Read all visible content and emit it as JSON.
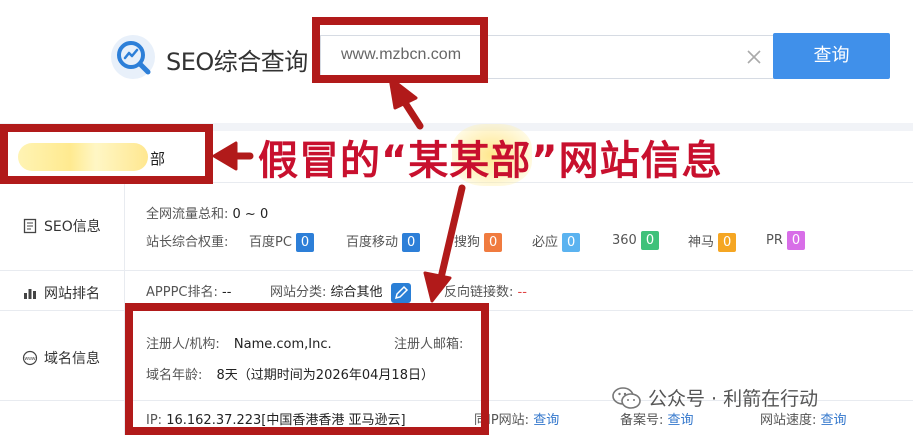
{
  "header": {
    "logo_text": "SEO综合查询",
    "search_value": "www.mzbcn.com",
    "search_button": "查询"
  },
  "site": {
    "name_suffix": "部"
  },
  "seo_info": {
    "label": "SEO信息",
    "traffic_label": "全网流量总和:",
    "traffic_value": "0 ~ 0",
    "weight_label": "站长综合权重:",
    "engines": [
      {
        "name": "百度PC",
        "value": "0",
        "color": "#2d7fd8"
      },
      {
        "name": "百度移动",
        "value": "0",
        "color": "#2d7fd8"
      },
      {
        "name": "搜狗",
        "value": "0",
        "color": "#f07b3f"
      },
      {
        "name": "必应",
        "value": "0",
        "color": "#5bb3f0"
      },
      {
        "name": "360",
        "value": "0",
        "color": "#3fc17a"
      },
      {
        "name": "神马",
        "value": "0",
        "color": "#f5a623"
      },
      {
        "name": "PR",
        "value": "0",
        "color": "#d86ee8"
      }
    ]
  },
  "ranking": {
    "label": "网站排名",
    "apppc_label": "APPPC排名:",
    "apppc_value": "--",
    "category_label": "网站分类:",
    "category_value": "综合其他",
    "backlinks_label": "反向链接数:",
    "backlinks_value": "--"
  },
  "domain": {
    "label": "域名信息",
    "registrant_label": "注册人/机构:",
    "registrant_value": "Name.com,Inc.",
    "email_label": "注册人邮箱:",
    "age_label": "域名年龄:",
    "age_value": "8天（过期时间为2026年04月18日）",
    "ip_label": "IP:",
    "ip_value": "16.162.37.223[中国香港香港 亚马逊云]",
    "sameip_label": "同IP网站:",
    "sameip_value": "查询",
    "icp_label": "备案号:",
    "icp_value": "查询",
    "speed_label": "网站速度:",
    "speed_value": "查询"
  },
  "annotation": {
    "title_part1": "假冒的“",
    "title_part2": "某某部",
    "title_part3": "”网站信息",
    "color": "#c8102e"
  },
  "watermark": "公众号 · 利箭在行动"
}
